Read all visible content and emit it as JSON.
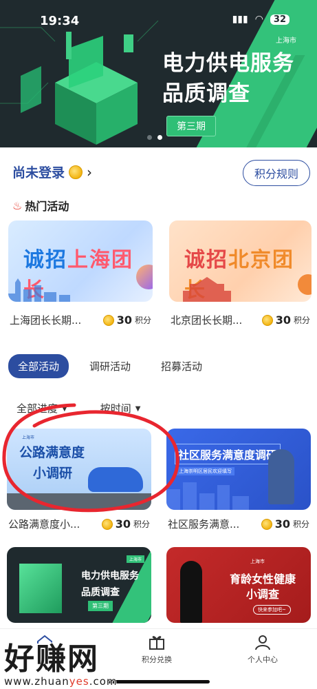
{
  "status_bar": {
    "time": "19:34",
    "battery": "32"
  },
  "banner": {
    "city_tag": "上海市",
    "title_line1": "电力供电服务",
    "title_line2": "品质调查",
    "issue": "第三期"
  },
  "login": {
    "label": "尚未登录",
    "rules_button": "积分规则"
  },
  "hot": {
    "heading": "热门活动",
    "cards": [
      {
        "title": "上海团长长期...",
        "points": "30",
        "unit": "积分",
        "img_prefix": "诚招",
        "img_main": "上海团长"
      },
      {
        "title": "北京团长长期...",
        "points": "30",
        "unit": "积分",
        "img_prefix": "诚招",
        "img_main": "北京团长"
      }
    ]
  },
  "tabs": [
    {
      "label": "全部活动",
      "active": true
    },
    {
      "label": "调研活动",
      "active": false
    },
    {
      "label": "招募活动",
      "active": false
    }
  ],
  "filters": {
    "progress": "全部进度",
    "time": "按时间"
  },
  "activities": [
    {
      "title": "公路满意度小...",
      "points": "30",
      "unit": "积分",
      "img_line1": "公路满意度",
      "img_line2": "小调研",
      "img_city": "上海市"
    },
    {
      "title": "社区服务满意...",
      "points": "30",
      "unit": "积分",
      "img_line1": "社区服务满意度调研",
      "img_line2": "上海崇明区居民欢迎填写"
    },
    {
      "img_line1": "电力供电服务",
      "img_line2": "品质调查",
      "img_issue": "第三期",
      "img_city": "上海市"
    },
    {
      "img_line1": "育龄女性健康",
      "img_line2": "小调查",
      "img_city": "上海市",
      "img_cta": "快来参加吧~"
    }
  ],
  "bottom_nav": [
    {
      "label": "活动",
      "icon": "home-icon",
      "active": true
    },
    {
      "label": "积分兑换",
      "icon": "gift-icon",
      "active": false
    },
    {
      "label": "个人中心",
      "icon": "user-icon",
      "active": false
    }
  ],
  "watermark": {
    "big": "好赚网",
    "small_a": "www.zhuan",
    "small_b": "yes",
    "small_c": ".com"
  },
  "colors": {
    "primary": "#2c4da0",
    "green": "#33c27a",
    "annotation": "#e8262f"
  }
}
